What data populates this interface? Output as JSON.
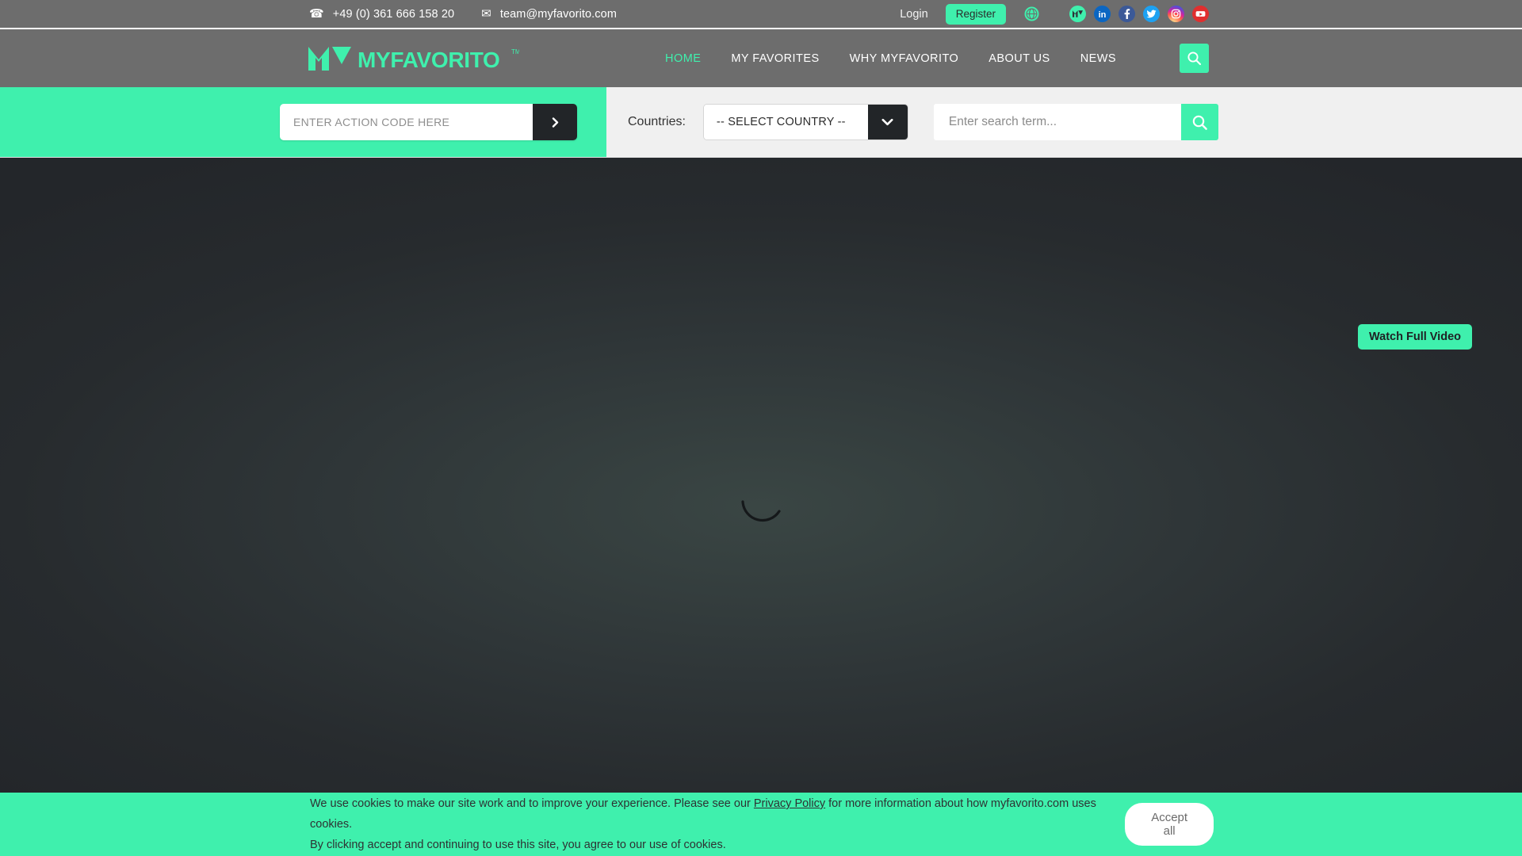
{
  "topbar": {
    "phone_icon": "telephone-icon",
    "phone": "+49 (0) 361 666 158 20",
    "email_icon": "envelope-icon",
    "email": "team@myfavorito.com",
    "login_label": "Login",
    "register_label": "Register",
    "social": [
      {
        "name": "globe-icon",
        "title": "Language"
      },
      {
        "name": "myfavorito-icon",
        "title": "MyFavorito"
      },
      {
        "name": "linkedin-icon",
        "title": "LinkedIn"
      },
      {
        "name": "facebook-icon",
        "title": "Facebook"
      },
      {
        "name": "twitter-icon",
        "title": "Twitter"
      },
      {
        "name": "instagram-icon",
        "title": "Instagram"
      },
      {
        "name": "youtube-icon",
        "title": "YouTube"
      }
    ]
  },
  "header": {
    "logo_text": "MYFAVORITO",
    "logo_tm": "TM",
    "nav": [
      {
        "label": "HOME",
        "active": true
      },
      {
        "label": "MY FAVORITES",
        "active": false
      },
      {
        "label": "WHY MYFAVORITO",
        "active": false
      },
      {
        "label": "ABOUT US",
        "active": false
      },
      {
        "label": "NEWS",
        "active": false
      }
    ],
    "search_icon": "search-icon"
  },
  "strip": {
    "action_code_placeholder": "ENTER ACTION CODE HERE",
    "action_code_value": "",
    "action_code_submit_icon": "chevron-right-icon",
    "countries_label": "Countries:",
    "country_selected": "-- SELECT COUNTRY --",
    "country_arrow_icon": "chevron-down-icon",
    "search_placeholder": "Enter search term...",
    "search_value": "",
    "search_icon": "search-icon"
  },
  "hero": {
    "watch_label": "Watch Full Video",
    "spinner_name": "loading-spinner"
  },
  "cookie": {
    "line1_before": "We use cookies to make our site work and to improve your experience. Please see our ",
    "privacy_link": "Privacy Policy",
    "line1_after": " for more information about how myfavorito.com uses cookies.",
    "line2": "By clicking accept and continuing to use this site, you agree to our use of cookies.",
    "accept_label": "Accept all"
  },
  "colors": {
    "accent": "#3ff0ad",
    "header_bg": "#6d6d6d",
    "dark": "#222528",
    "strip_grey": "#f0f0f0"
  }
}
